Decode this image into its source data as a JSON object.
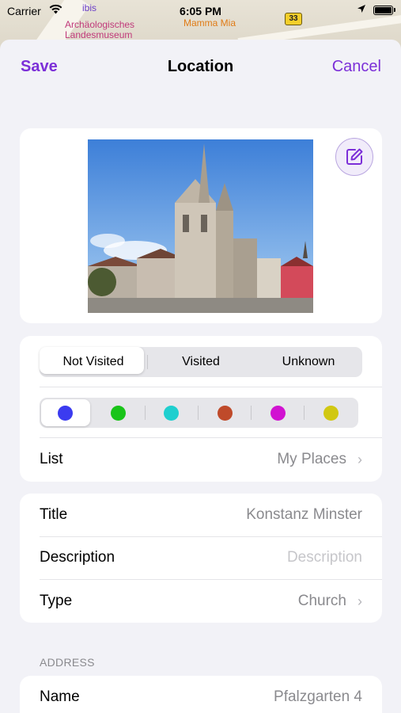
{
  "status_bar": {
    "carrier": "Carrier",
    "time": "6:05 PM"
  },
  "map": {
    "poi_ibis": "ibis",
    "poi_museum_line1": "Archäologisches",
    "poi_museum_line2": "Landesmuseum",
    "poi_restaurant": "Mamma Mia",
    "road_number": "33"
  },
  "nav": {
    "save_label": "Save",
    "title": "Location",
    "cancel_label": "Cancel"
  },
  "visit_status": {
    "options": [
      "Not Visited",
      "Visited",
      "Unknown"
    ],
    "selected": "Unknown"
  },
  "pin_colors": {
    "options": [
      "#3b3bf0",
      "#19c419",
      "#1fcfcf",
      "#bf4a2a",
      "#d112d1",
      "#d1c812"
    ],
    "selected_index": 0
  },
  "list_row": {
    "label": "List",
    "value": "My Places"
  },
  "details": {
    "title_label": "Title",
    "title_value": "Konstanz Minster",
    "description_label": "Description",
    "description_placeholder": "Description",
    "type_label": "Type",
    "type_value": "Church"
  },
  "address": {
    "header": "ADDRESS",
    "name_label": "Name",
    "name_value": "Pfalzgarten 4"
  },
  "colors": {
    "accent": "#7c2fd8",
    "background": "#f2f2f7",
    "secondary_text": "#8a8a8e"
  }
}
